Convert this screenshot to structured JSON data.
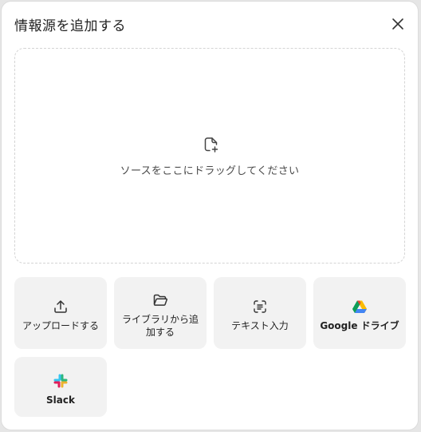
{
  "dialog": {
    "title": "情報源を追加する"
  },
  "dropzone": {
    "text": "ソースをここにドラッグしてください",
    "icon": "add-file-icon"
  },
  "sources": [
    {
      "label": "アップロードする",
      "icon": "upload-icon"
    },
    {
      "label": "ライブラリから追加する",
      "icon": "folder-icon"
    },
    {
      "label": "テキスト入力",
      "icon": "text-scan-icon"
    },
    {
      "label": "Google ドライブ",
      "icon": "google-drive-icon"
    },
    {
      "label": "Slack",
      "icon": "slack-icon"
    }
  ]
}
